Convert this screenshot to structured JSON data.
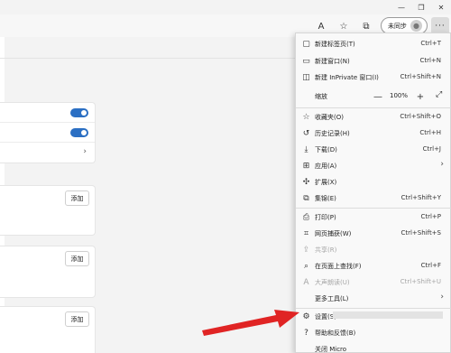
{
  "toolbar": {
    "profile_label": "未同步",
    "more_label": "···",
    "icons": [
      "read-aloud-icon",
      "favorites-star-icon",
      "collections-icon",
      "profile-icon"
    ]
  },
  "page": {
    "add_label_1": "添加",
    "add_label_2": "添加",
    "add_label_3": "添加"
  },
  "menu": {
    "items": [
      {
        "label": "新建标签页(T)",
        "shortcut": "Ctrl+T",
        "icon": "new-tab-icon"
      },
      {
        "label": "新建窗口(N)",
        "shortcut": "Ctrl+N",
        "icon": "new-window-icon"
      },
      {
        "label": "新建 InPrivate 窗口(I)",
        "shortcut": "Ctrl+Shift+N",
        "icon": "inprivate-icon"
      },
      {
        "label": "缩放",
        "shortcut": "",
        "icon": ""
      },
      {
        "label": "收藏夹(O)",
        "shortcut": "Ctrl+Shift+O",
        "icon": "favorites-icon"
      },
      {
        "label": "历史记录(H)",
        "shortcut": "Ctrl+H",
        "icon": "history-icon"
      },
      {
        "label": "下载(D)",
        "shortcut": "Ctrl+J",
        "icon": "download-icon"
      },
      {
        "label": "应用(A)",
        "shortcut": "",
        "icon": "apps-icon"
      },
      {
        "label": "扩展(X)",
        "shortcut": "",
        "icon": "extensions-icon"
      },
      {
        "label": "集锦(E)",
        "shortcut": "Ctrl+Shift+Y",
        "icon": "collections-icon"
      },
      {
        "label": "打印(P)",
        "shortcut": "Ctrl+P",
        "icon": "print-icon"
      },
      {
        "label": "网页捕获(W)",
        "shortcut": "Ctrl+Shift+S",
        "icon": "web-capture-icon"
      },
      {
        "label": "共享(R)",
        "shortcut": "",
        "icon": "share-icon"
      },
      {
        "label": "在页面上查找(F)",
        "shortcut": "Ctrl+F",
        "icon": "find-icon"
      },
      {
        "label": "大声朗读(U)",
        "shortcut": "Ctrl+Shift+U",
        "icon": "read-aloud-icon"
      },
      {
        "label": "更多工具(L)",
        "shortcut": "",
        "icon": ""
      },
      {
        "label": "设置(S)",
        "shortcut": "",
        "icon": "settings-gear-icon"
      },
      {
        "label": "帮助和反馈(B)",
        "shortcut": "",
        "icon": "help-icon"
      },
      {
        "label": "关闭 Micro",
        "shortcut": "",
        "icon": ""
      }
    ],
    "zoom": {
      "label": "缩放",
      "value": "100%",
      "minus": "—",
      "plus": "+"
    }
  },
  "colors": {
    "accent": "#2b6fc3",
    "arrow": "#e02424"
  }
}
